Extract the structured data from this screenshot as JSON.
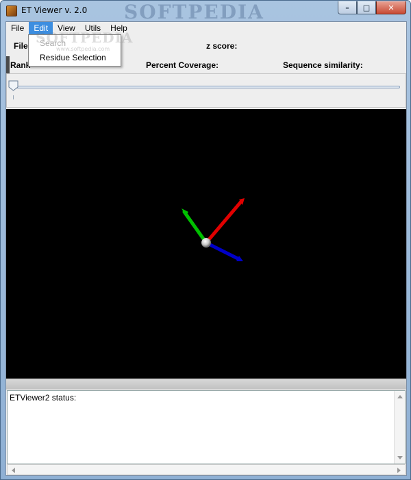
{
  "window": {
    "title": "ET Viewer v. 2.0",
    "watermark": "SOFTPEDIA",
    "buttons": {
      "minimize": "–",
      "maximize": "□",
      "close": "✕"
    }
  },
  "menubar": {
    "items": [
      {
        "label": "File",
        "active": false
      },
      {
        "label": "Edit",
        "active": true
      },
      {
        "label": "View",
        "active": false
      },
      {
        "label": "Utils",
        "active": false
      },
      {
        "label": "Help",
        "active": false
      }
    ]
  },
  "edit_menu": {
    "items": [
      {
        "label": "Search",
        "enabled": false
      },
      {
        "label": "Residue Selection",
        "enabled": true
      }
    ],
    "watermark": "SOFTPEDIA",
    "watermark_small": "www.softpedia.com"
  },
  "info": {
    "file_label": "File",
    "zscore_label": "z score:",
    "rank_label": "Rank",
    "coverage_label": "Percent Coverage:",
    "similarity_label": "Sequence similarity:"
  },
  "slider": {
    "value": 0
  },
  "status": {
    "text": "ETViewer2 status:"
  },
  "colors": {
    "menu_highlight": "#3d8ee0",
    "axis_x": "#e00000",
    "axis_y": "#00c000",
    "axis_z": "#0000c8",
    "viewport_bg": "#000000"
  },
  "icons": [
    "app-icon",
    "minimize-icon",
    "maximize-icon",
    "close-icon",
    "slider-thumb-icon",
    "scroll-up-icon",
    "scroll-down-icon",
    "scroll-left-icon",
    "scroll-right-icon"
  ]
}
